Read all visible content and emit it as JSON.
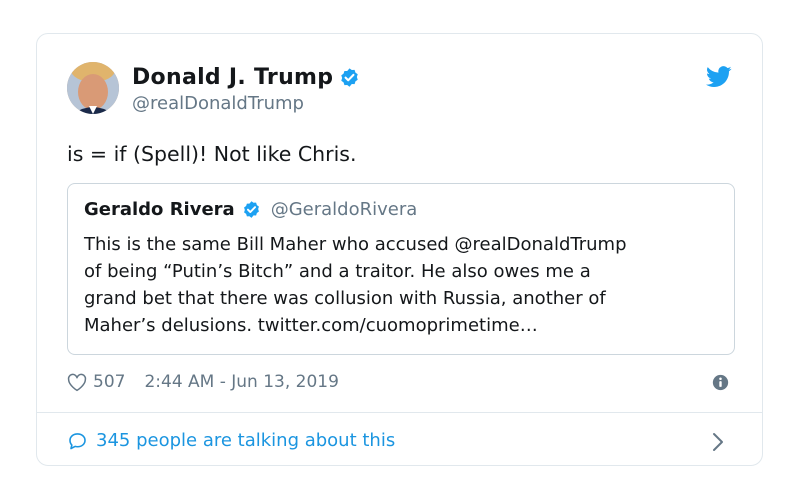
{
  "tweet": {
    "author": {
      "name": "Donald J. Trump",
      "handle": "@realDonaldTrump"
    },
    "text": "is = if (Spell)! Not like Chris.",
    "quoted": {
      "name": "Geraldo Rivera",
      "handle": "@GeraldoRivera",
      "text_lines": [
        "This is the same Bill Maher who accused @realDonaldTrump",
        "of being “Putin’s Bitch” and a traitor. He also owes me a",
        "grand bet that there was collusion with Russia, another of",
        "Maher’s delusions. twitter.com/cuomoprimetime…"
      ]
    },
    "likes": "507",
    "timestamp": "2:44 AM - Jun 13, 2019",
    "talking": "345 people are talking about this"
  },
  "icons": {
    "verified": "verified-badge-icon",
    "bird": "twitter-bird-icon",
    "heart": "heart-icon",
    "info": "info-icon",
    "bubble": "speech-bubble-icon",
    "chevron": "chevron-right-icon"
  },
  "colors": {
    "brand_blue": "#1da1f2",
    "link_blue": "#1b95e0",
    "secondary_text": "#657786",
    "border": "#e1e8ed"
  }
}
